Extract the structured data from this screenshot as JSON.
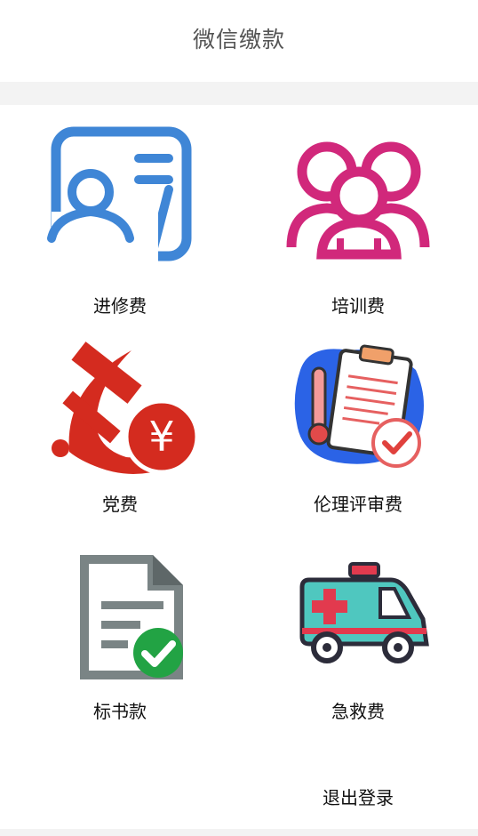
{
  "header": {
    "title": "微信缴款"
  },
  "tiles": [
    {
      "label": "进修费",
      "icon": "person-card-icon",
      "color": "#3f86d6"
    },
    {
      "label": "培训费",
      "icon": "group-people-icon",
      "color": "#d1287b"
    },
    {
      "label": "党费",
      "icon": "hammer-sickle-yen-icon",
      "color": "#d42b1f"
    },
    {
      "label": "伦理评审费",
      "icon": "clipboard-thermometer-check-icon",
      "color": "#2b63e6"
    },
    {
      "label": "标书款",
      "icon": "document-check-icon",
      "color": "#7a8485"
    },
    {
      "label": "急救费",
      "icon": "ambulance-icon",
      "color": "#4fc7bf"
    }
  ],
  "footer": {
    "logout_label": "退出登录"
  }
}
